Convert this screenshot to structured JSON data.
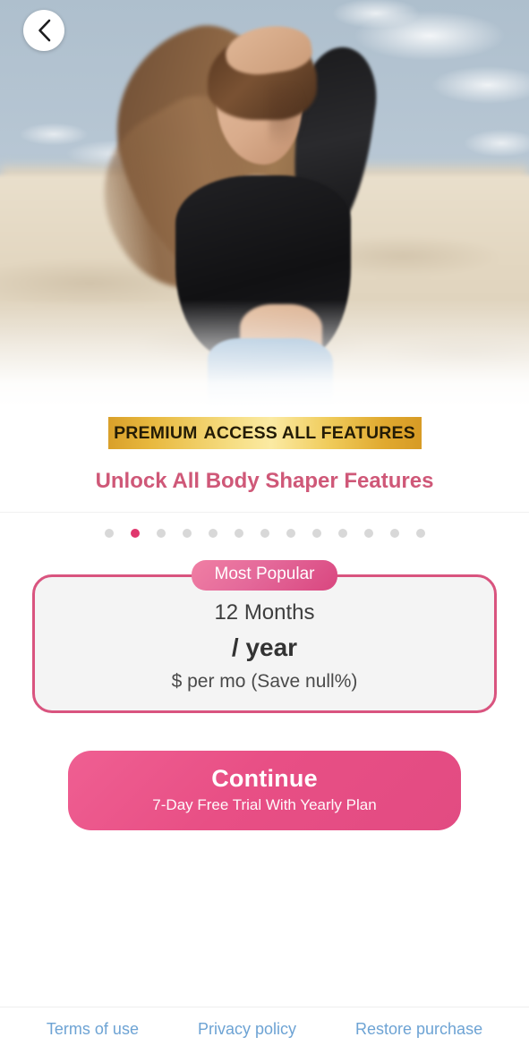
{
  "header": {
    "back_icon": "chevron-left-icon"
  },
  "hero": {
    "alt": "woman-in-desert-photo"
  },
  "promo": {
    "badge_primary": "PREMIUM",
    "badge_secondary": "ACCESS ALL FEATURES",
    "title": "Unlock All Body Shaper Features",
    "badge_gradient_start": "#d9a02a",
    "badge_gradient_mid": "#fbeaa3",
    "title_color": "#cf5878"
  },
  "carousel": {
    "total_dots": 13,
    "active_index": 1,
    "active_color": "#e0366d",
    "inactive_color": "#d8d8d8"
  },
  "plan": {
    "popular_label": "Most Popular",
    "duration": "12 Months",
    "price": "/ year",
    "per_month": "$ per mo (Save null%)",
    "border_color": "#d9547f",
    "pill_color": "#d9467f"
  },
  "cta": {
    "label": "Continue",
    "subtitle": "7-Day Free Trial With Yearly Plan",
    "color": "#e84f85"
  },
  "footer": {
    "links": [
      {
        "label": "Terms of use"
      },
      {
        "label": "Privacy policy"
      },
      {
        "label": "Restore purchase"
      }
    ],
    "link_color": "#6da3d4"
  }
}
